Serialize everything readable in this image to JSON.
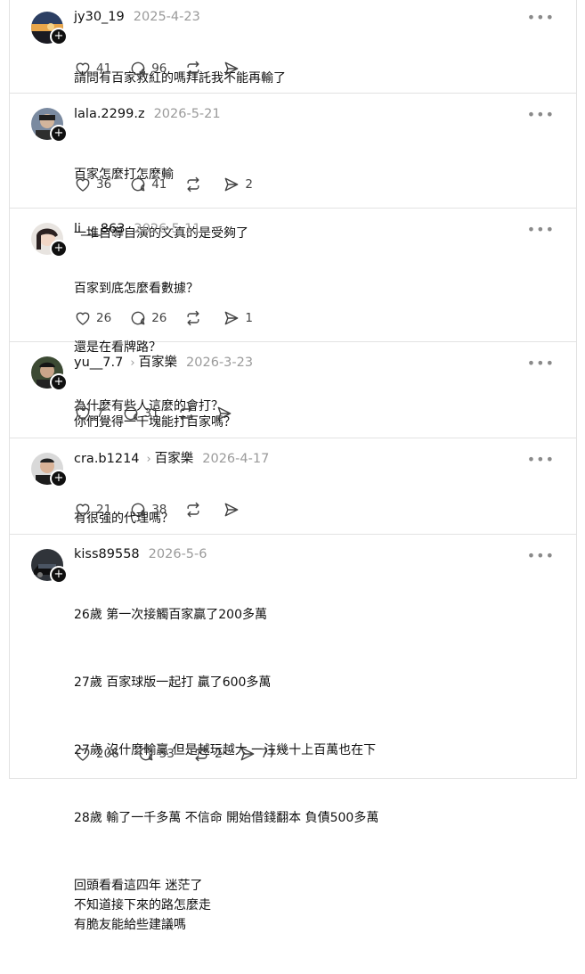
{
  "posts": [
    {
      "username": "jy30_19",
      "topic": "",
      "date": "2025-4-23",
      "lines": [
        "請問有百家救紅的嗎拜託我不能再輸了"
      ],
      "likes": "41",
      "comments": "96",
      "reposts": "",
      "shares": ""
    },
    {
      "username": "lala.2299.z",
      "topic": "",
      "date": "2026-5-21",
      "lines": [
        "百家怎麼打怎麼輸",
        "一堆自導自演的文真的是受夠了"
      ],
      "likes": "36",
      "comments": "41",
      "reposts": "",
      "shares": "2"
    },
    {
      "username": "li___863",
      "topic": "",
      "date": "2026-5-11",
      "lines": [
        "百家到底怎麼看數據？",
        "還是在看牌路？",
        "為什麼有些人這麼的會打？"
      ],
      "likes": "26",
      "comments": "26",
      "reposts": "",
      "shares": "1"
    },
    {
      "username": "yu__7.7",
      "topic": "百家樂",
      "date": "2026-3-23",
      "lines": [
        "你們覺得一千塊能打百家嗎？"
      ],
      "likes": "7",
      "comments": "31",
      "reposts": "",
      "shares": ""
    },
    {
      "username": "cra.b1214",
      "topic": "百家樂",
      "date": "2026-4-17",
      "lines": [
        "有很強的代理嗎？"
      ],
      "likes": "21",
      "comments": "38",
      "reposts": "",
      "shares": ""
    },
    {
      "username": "kiss89558",
      "topic": "",
      "date": "2026-5-6",
      "lines": [
        "26歲 第一次接觸百家贏了200多萬",
        "27歲 百家球版一起打 贏了600多萬",
        "27歲 沒什麼輸贏 但是越玩越大 一注幾十上百萬也在下",
        "28歲 輸了一千多萬 不信命 開始借錢翻本 負債500多萬",
        "回頭看看這四年 迷茫了\n不知道接下來的路怎麼走\n有脆友能給些建議嗎"
      ],
      "likes": "206",
      "comments": "53",
      "reposts": "2",
      "shares": "77"
    }
  ],
  "icons": {
    "like": "heart-icon",
    "comment": "comment-bubble-icon",
    "repost": "repost-icon",
    "share": "send-icon",
    "more": "more-options-icon",
    "follow": "plus-icon"
  },
  "colors": {
    "text": "#101010",
    "muted": "#9a9a9a",
    "divider": "#e2e2e2",
    "icon": "#444444"
  }
}
